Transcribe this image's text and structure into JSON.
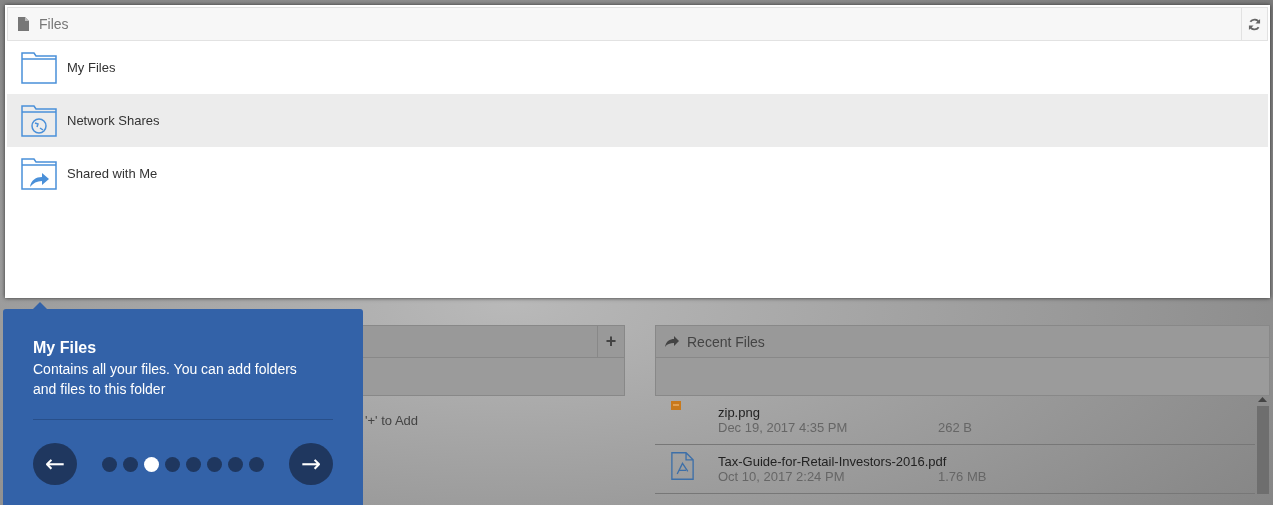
{
  "files_panel": {
    "title": "Files",
    "items": [
      {
        "label": "My Files",
        "kind": "plain",
        "selected": false
      },
      {
        "label": "Network Shares",
        "kind": "network",
        "selected": true
      },
      {
        "label": "Shared with Me",
        "kind": "shared",
        "selected": false
      }
    ]
  },
  "folders_panel": {
    "hint": "'+' to Add",
    "add_button": "+"
  },
  "recent_files": {
    "title": "Recent Files",
    "files": [
      {
        "name": "zip.png",
        "kind": "image",
        "date": "Dec 19, 2017 4:35 PM",
        "size": "262 B"
      },
      {
        "name": "Tax-Guide-for-Retail-Investors-2016.pdf",
        "kind": "pdf",
        "date": "Oct 10, 2017 2:24 PM",
        "size": "1.76 MB"
      }
    ]
  },
  "tour": {
    "title": "My Files",
    "text": "Contains all your files. You can add folders and files to this folder",
    "prev": "←",
    "next": "→",
    "steps": [
      {
        "selected": false
      },
      {
        "selected": false
      },
      {
        "selected": true
      },
      {
        "selected": false
      },
      {
        "selected": false
      },
      {
        "selected": false
      },
      {
        "selected": false
      },
      {
        "selected": false
      }
    ]
  }
}
